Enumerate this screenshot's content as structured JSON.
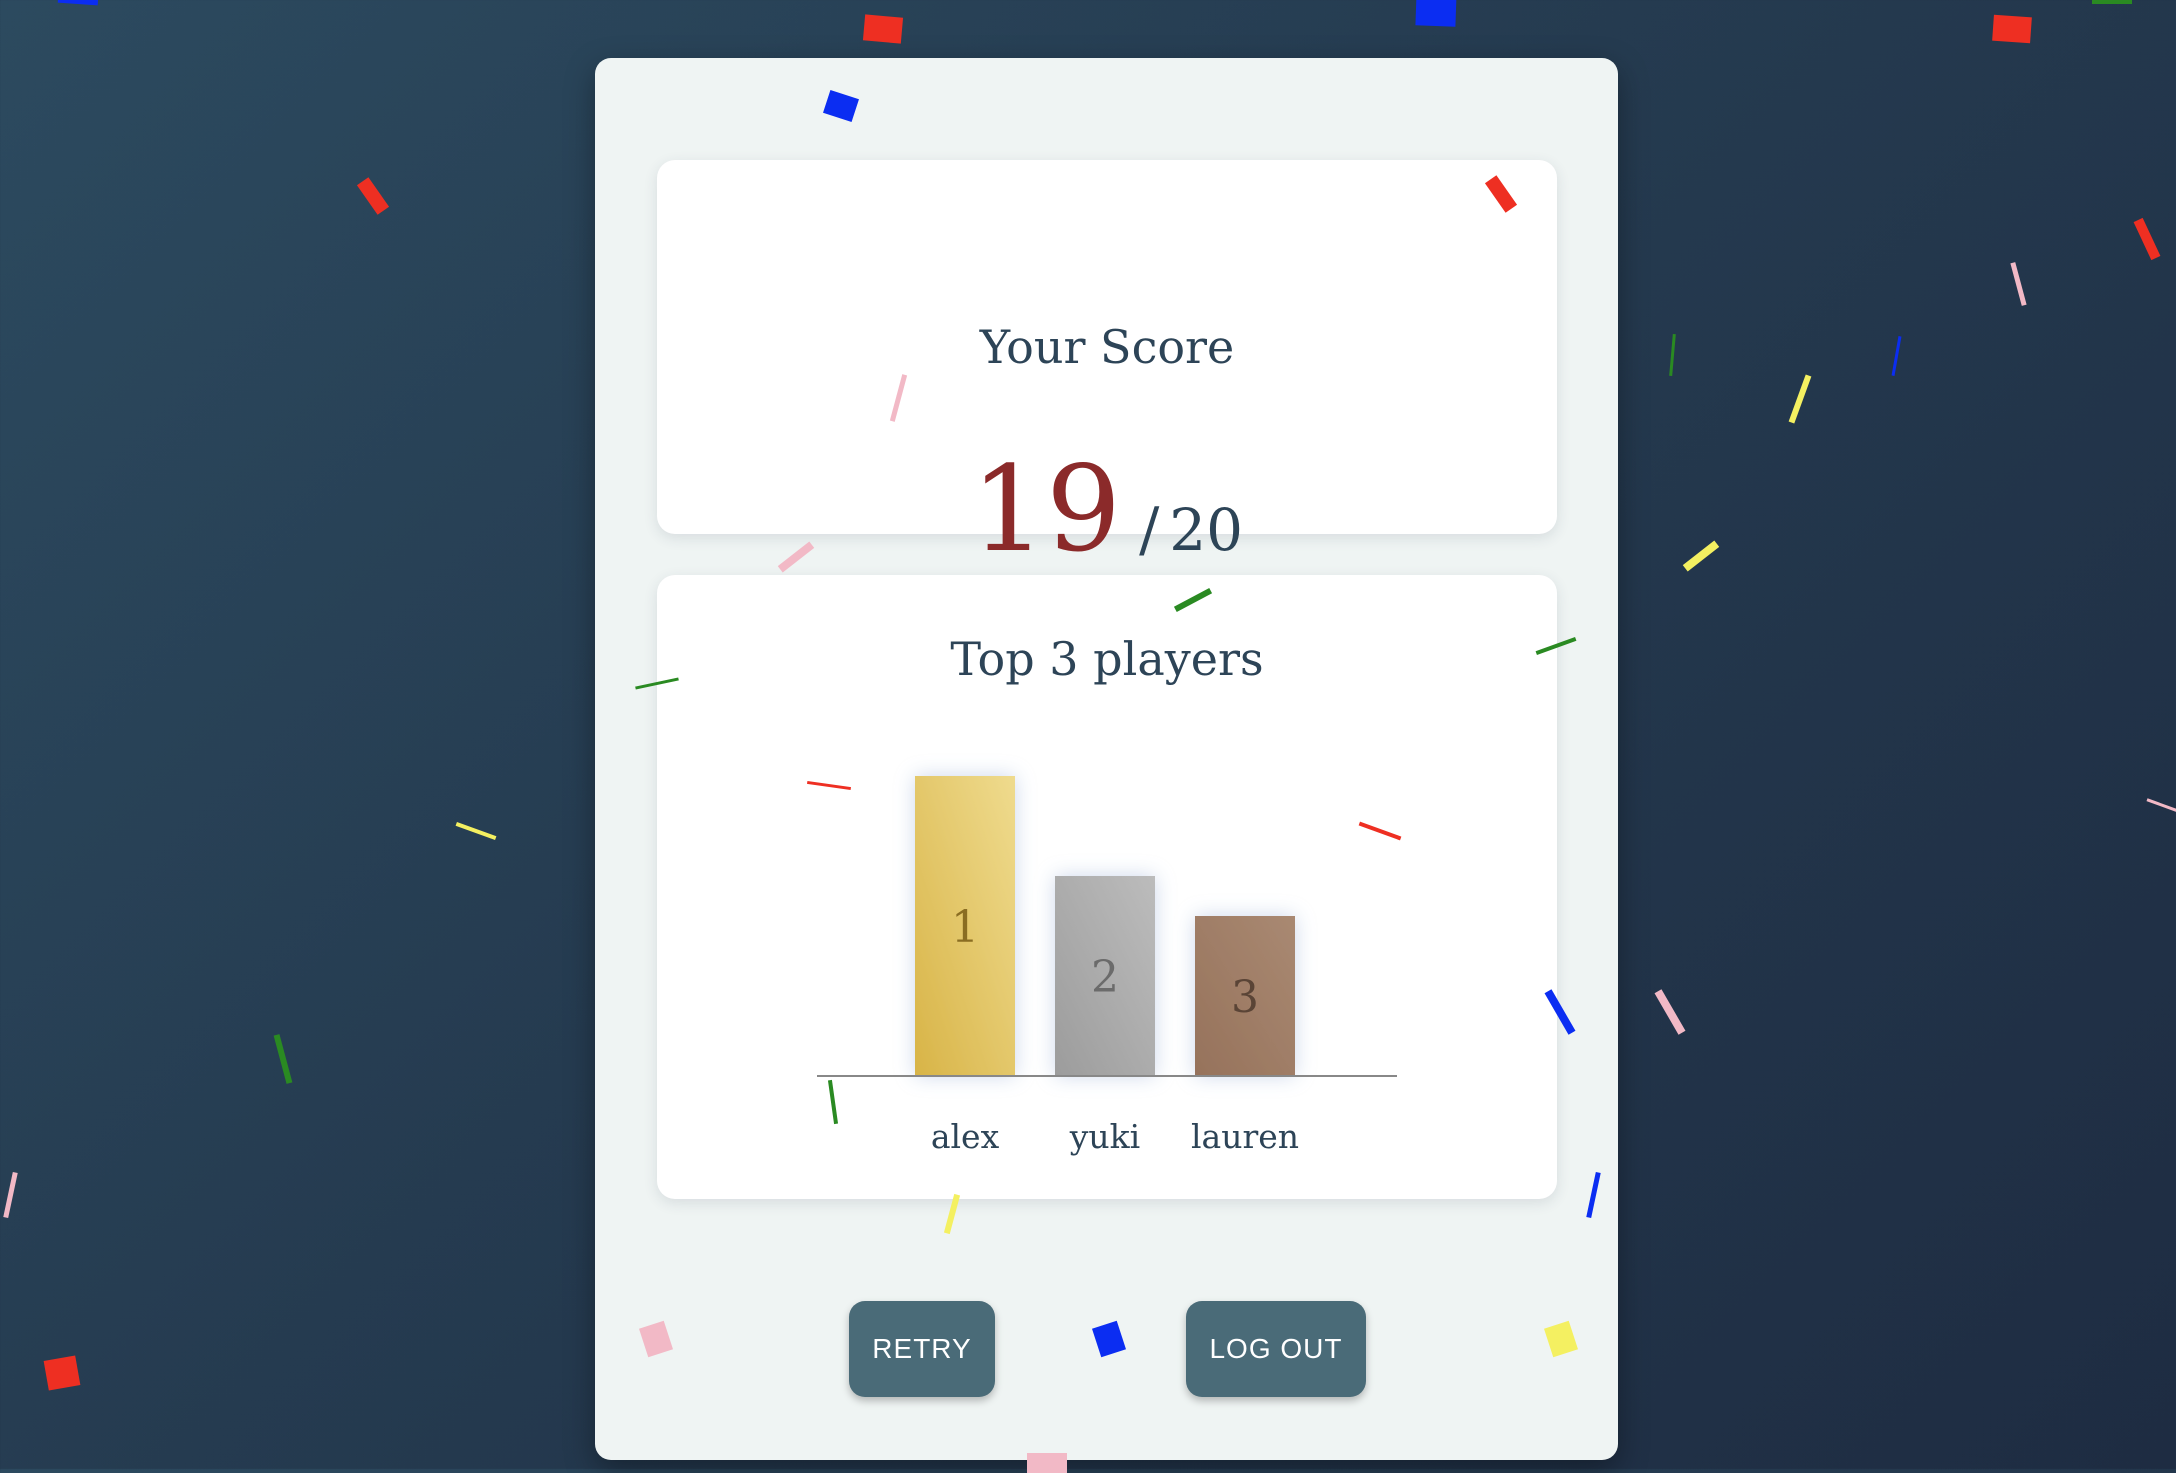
{
  "score_card": {
    "title": "Your Score",
    "score": "19",
    "separator": "/",
    "total": "20"
  },
  "leaderboard": {
    "title": "Top 3 players"
  },
  "chart_data": {
    "type": "bar",
    "title": "Top 3 players",
    "categories": [
      "alex",
      "yuki",
      "lauren"
    ],
    "values": [
      3,
      2,
      1.6
    ],
    "bar_labels": [
      "1",
      "2",
      "3"
    ],
    "bar_colors": [
      "#e3c35c",
      "#aaaaaa",
      "#9f7d66"
    ],
    "xlabel": "",
    "ylabel": "",
    "grid": false
  },
  "actions": {
    "retry_label": "RETRY",
    "logout_label": "LOG OUT"
  },
  "theme": {
    "accent": "#4a6b78",
    "score_color": "#8b2a2a",
    "text_color": "#2d4457"
  }
}
